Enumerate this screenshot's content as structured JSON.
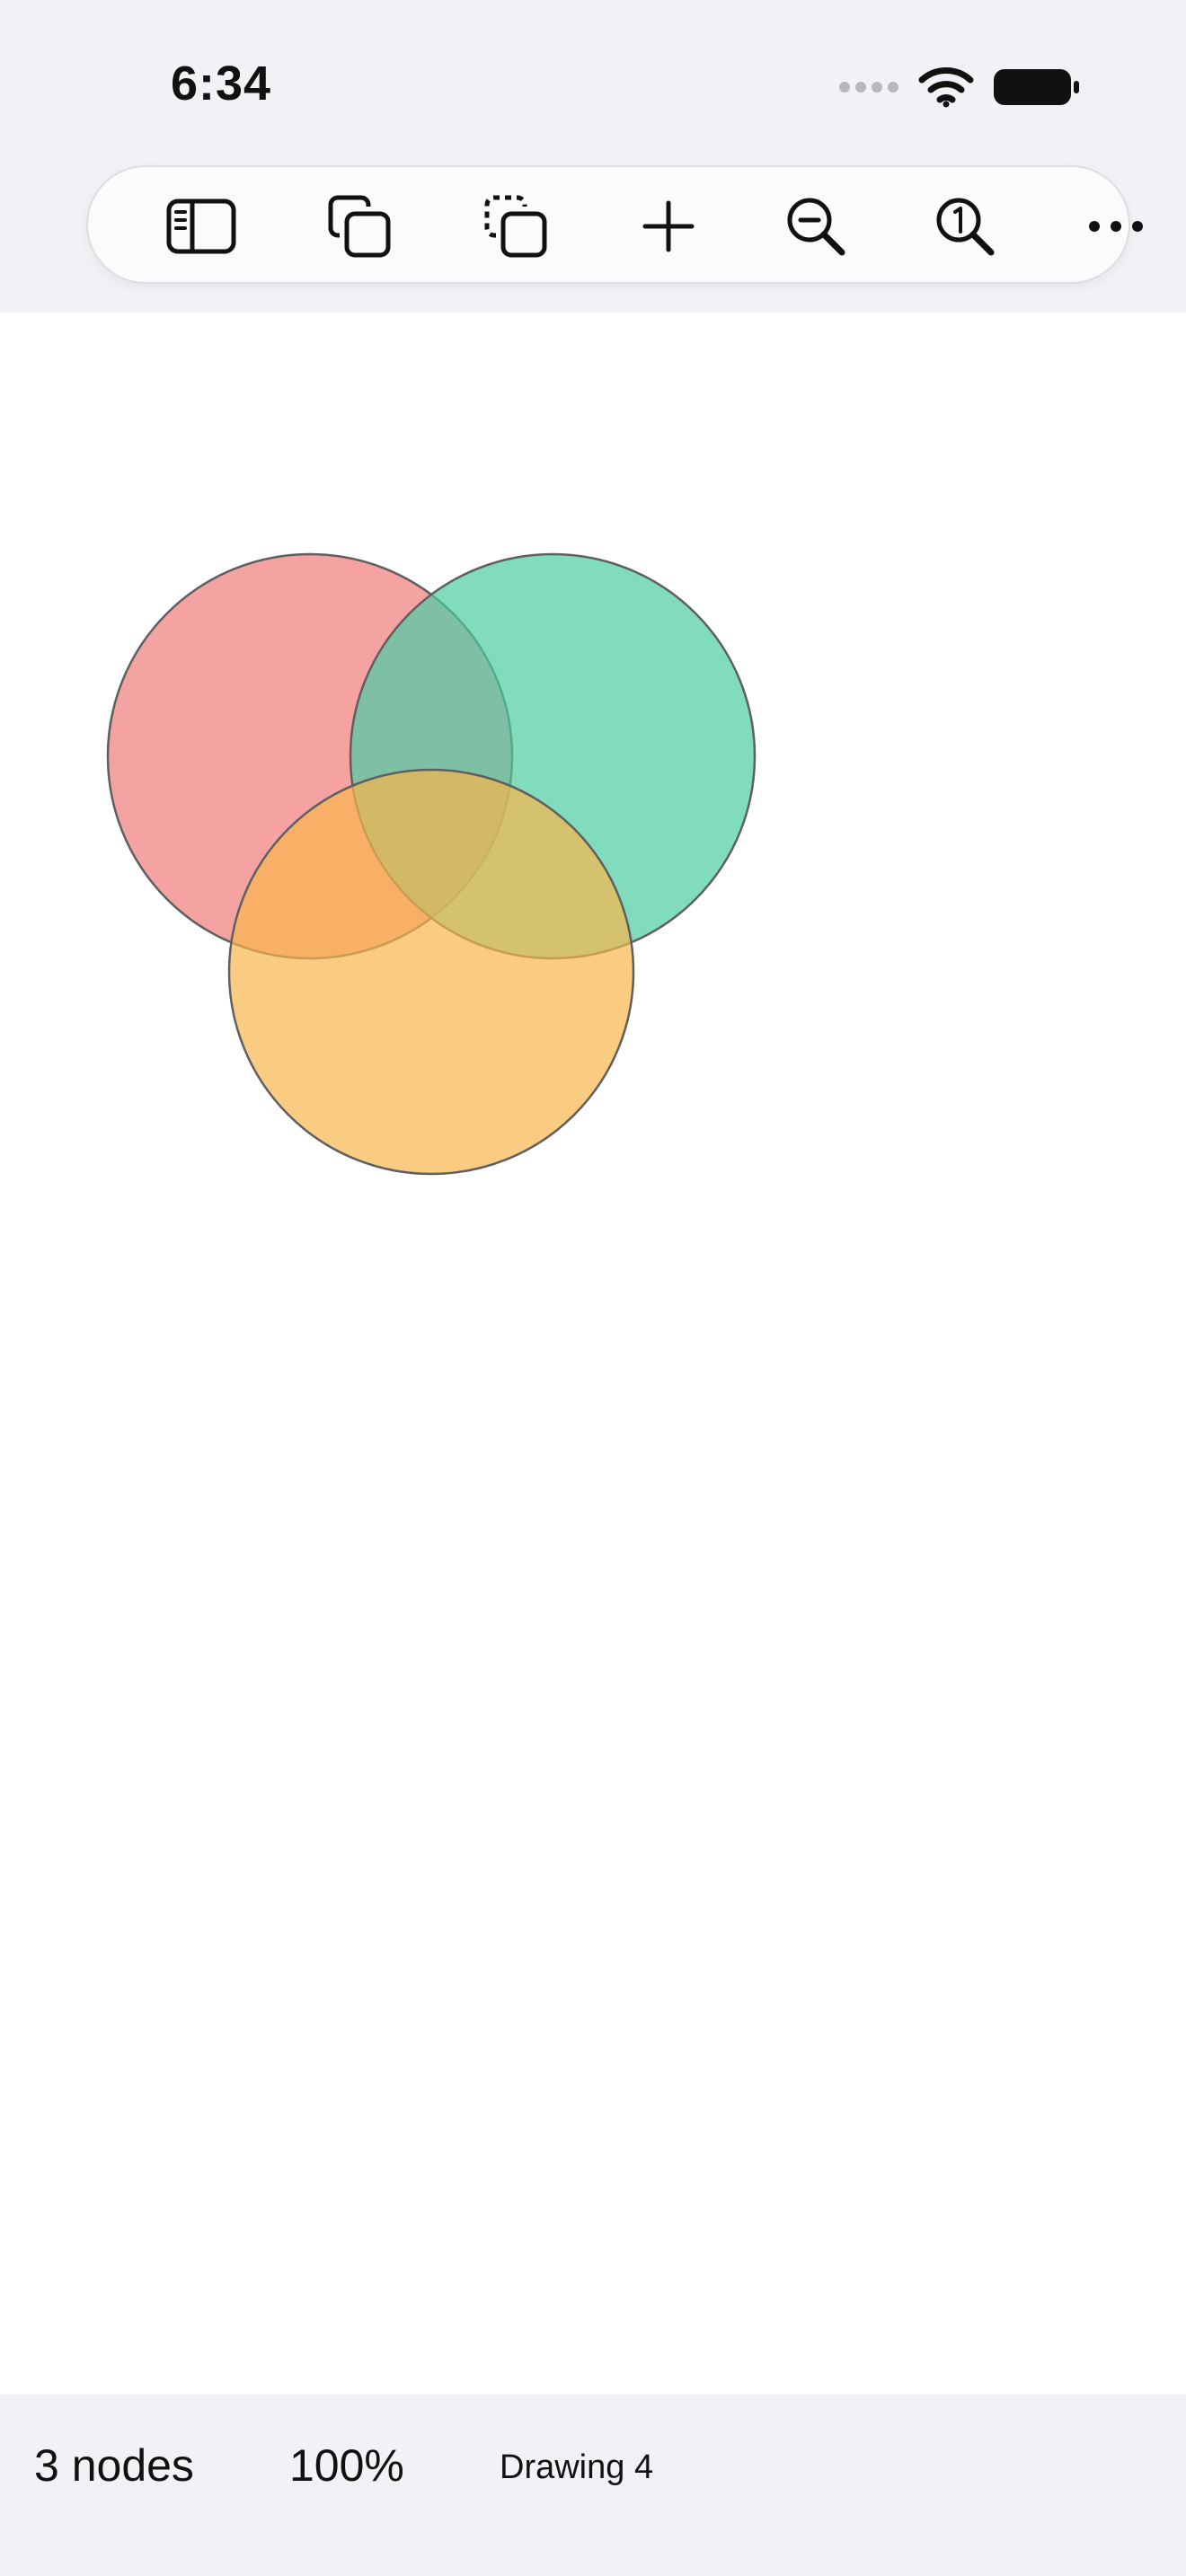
{
  "status_bar": {
    "time": "6:34",
    "icons": [
      "cellular-signal-icon",
      "wifi-icon",
      "battery-icon"
    ]
  },
  "toolbar": {
    "buttons": [
      {
        "icon": "sidebar-icon",
        "label": "Toggle sidebar"
      },
      {
        "icon": "duplicate-icon",
        "label": "Duplicate"
      },
      {
        "icon": "duplicate-dashed-icon",
        "label": "Duplicate selection"
      },
      {
        "icon": "plus-icon",
        "label": "Add"
      },
      {
        "icon": "zoom-out-icon",
        "label": "Zoom out"
      },
      {
        "icon": "zoom-actual-icon",
        "label": "Actual size"
      },
      {
        "icon": "more-icon",
        "label": "More"
      }
    ]
  },
  "canvas": {
    "nodes": [
      {
        "shape": "circle",
        "fill": "#f28b8c",
        "name": "red-circle"
      },
      {
        "shape": "circle",
        "fill": "#4ccda3",
        "name": "green-circle"
      },
      {
        "shape": "circle",
        "fill": "#f8b64c",
        "name": "orange-circle"
      }
    ],
    "stroke_color": "#5f5f5f"
  },
  "bottom_bar": {
    "node_count": "3 nodes",
    "zoom": "100%",
    "document_name": "Drawing 4"
  },
  "colors": {
    "chrome_background": "#f2f2f6",
    "canvas_background": "#ffffff",
    "icon_color": "#111111"
  }
}
